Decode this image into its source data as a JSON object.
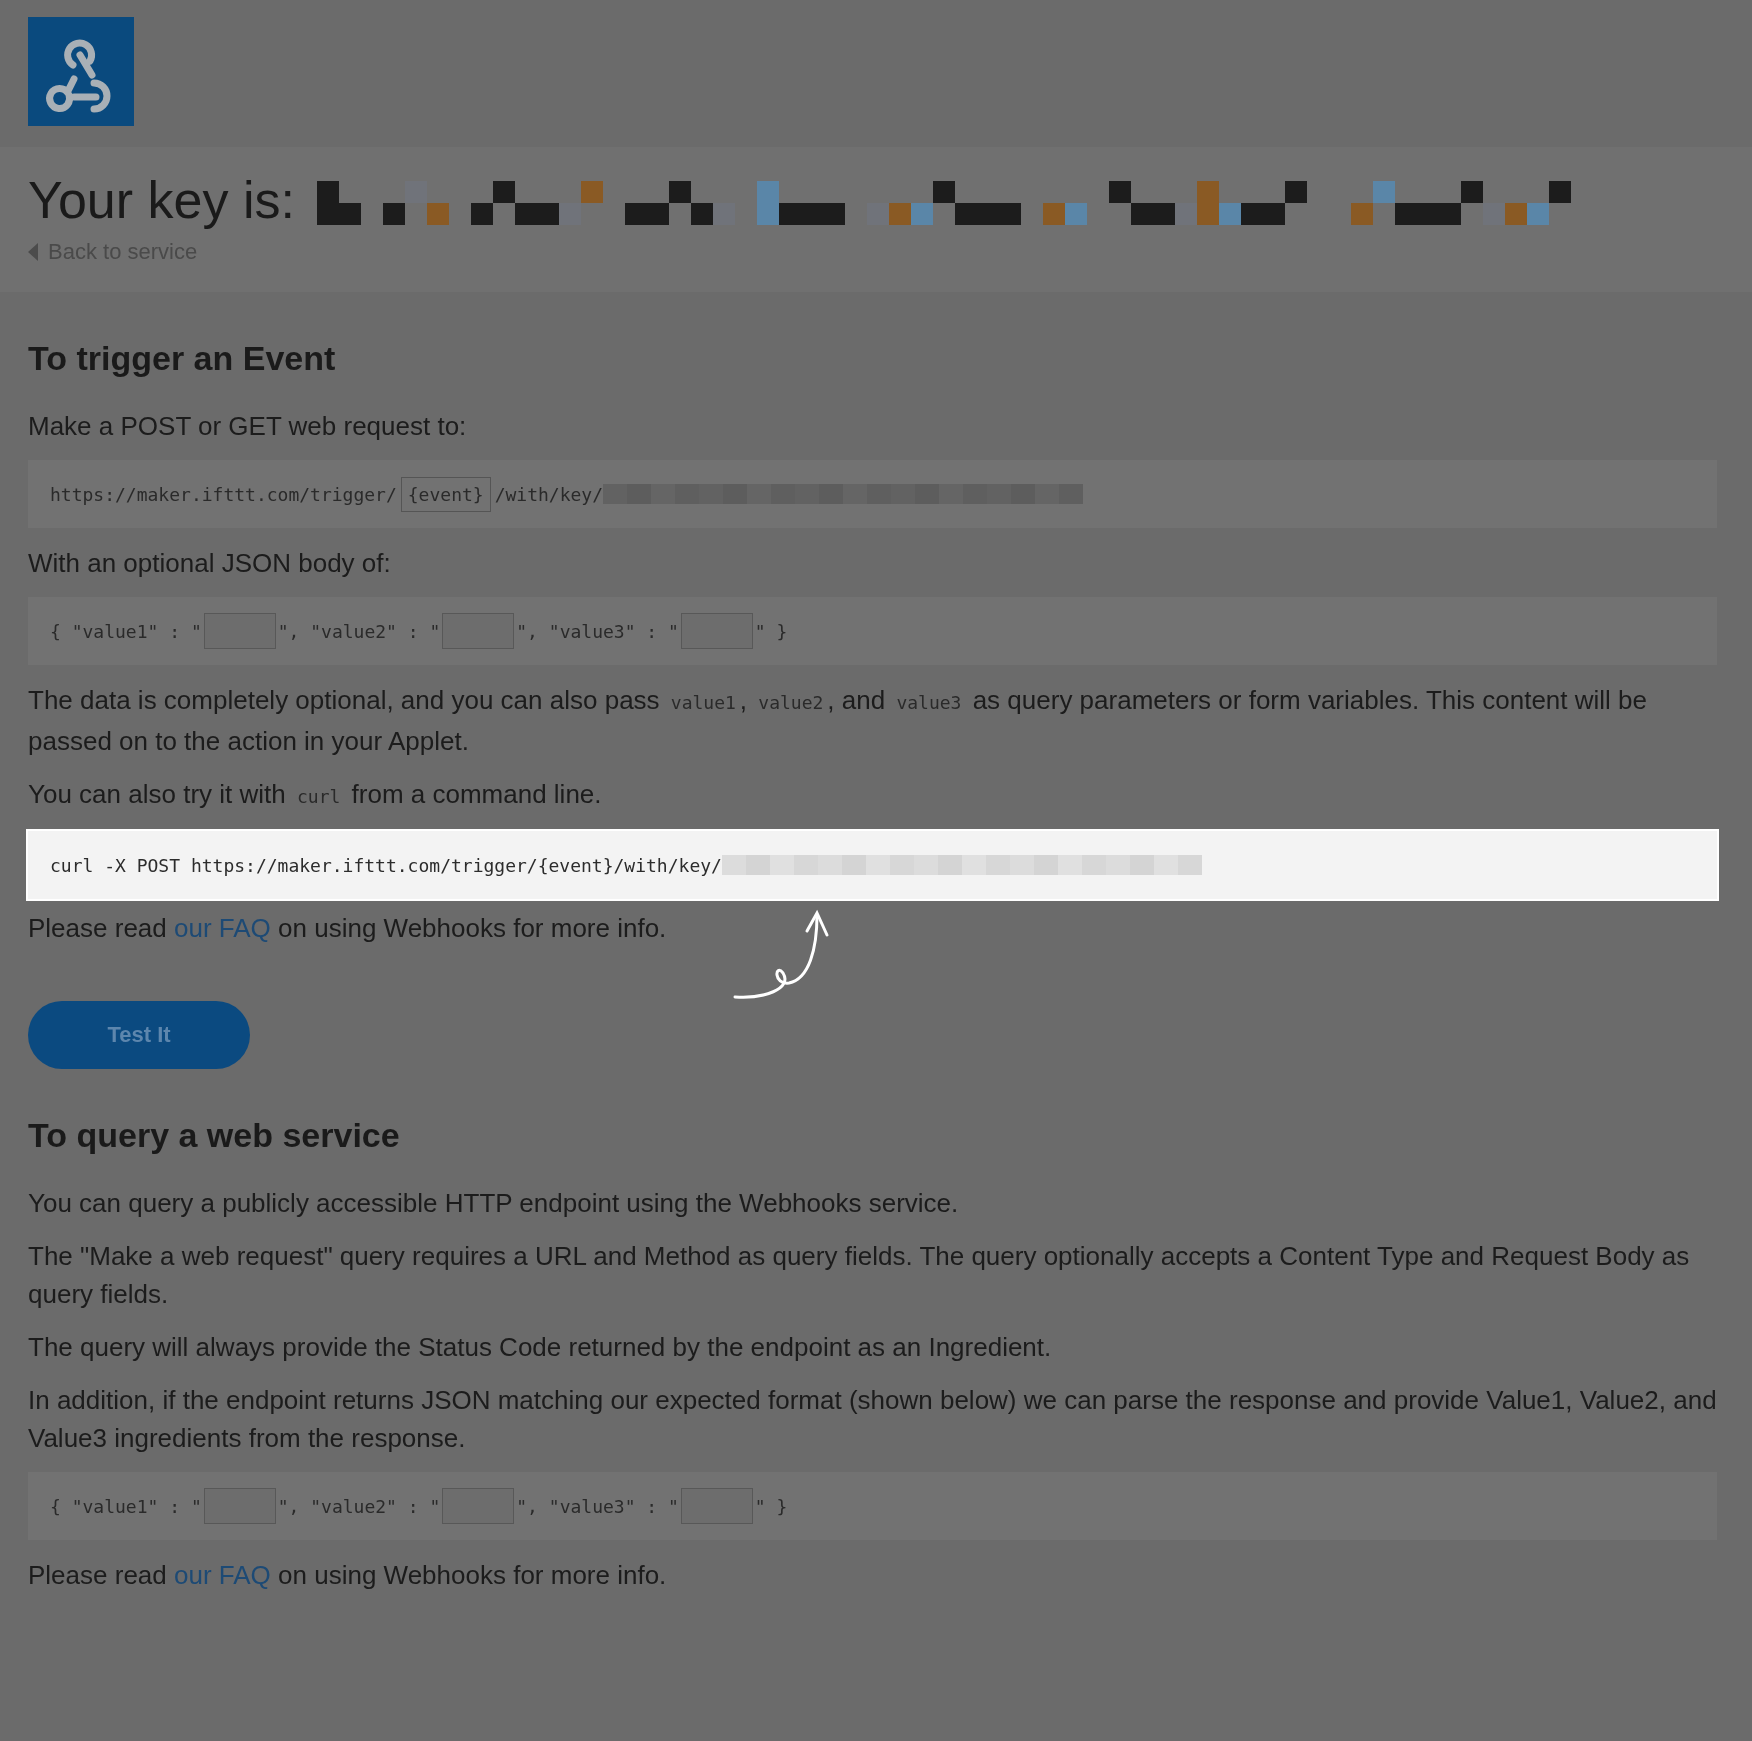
{
  "header": {
    "title": "Your key is:",
    "back_link": "Back to service"
  },
  "sections": [
    {
      "heading": "To trigger an Event",
      "blocks": [
        {
          "kind": "paragraph",
          "parts": [
            {
              "kind": "text",
              "text": "Make a POST or GET web request to:"
            }
          ]
        },
        {
          "kind": "code",
          "highlighted": false,
          "parts": [
            {
              "kind": "text",
              "text": "https://maker.ifttt.com/trigger/"
            },
            {
              "kind": "placeholder",
              "text": "{event}"
            },
            {
              "kind": "text",
              "text": "/with/key/"
            },
            {
              "kind": "redacted"
            }
          ]
        },
        {
          "kind": "paragraph",
          "parts": [
            {
              "kind": "text",
              "text": "With an optional JSON body of:"
            }
          ]
        },
        {
          "kind": "code",
          "highlighted": false,
          "parts": [
            {
              "kind": "text",
              "text": "{ \"value1\" : \""
            },
            {
              "kind": "field"
            },
            {
              "kind": "text",
              "text": "\", \"value2\" : \""
            },
            {
              "kind": "field"
            },
            {
              "kind": "text",
              "text": "\", \"value3\" : \""
            },
            {
              "kind": "field"
            },
            {
              "kind": "text",
              "text": "\" }"
            }
          ]
        },
        {
          "kind": "paragraph",
          "parts": [
            {
              "kind": "text",
              "text": "The data is completely optional, and you can also pass "
            },
            {
              "kind": "code",
              "text": "value1"
            },
            {
              "kind": "text",
              "text": ", "
            },
            {
              "kind": "code",
              "text": "value2"
            },
            {
              "kind": "text",
              "text": ", and "
            },
            {
              "kind": "code",
              "text": "value3"
            },
            {
              "kind": "text",
              "text": " as query parameters or form variables. This content will be passed on to the action in your Applet."
            }
          ]
        },
        {
          "kind": "paragraph",
          "parts": [
            {
              "kind": "text",
              "text": "You can also try it with "
            },
            {
              "kind": "code",
              "text": "curl"
            },
            {
              "kind": "text",
              "text": " from a command line."
            }
          ]
        },
        {
          "kind": "code",
          "highlighted": true,
          "parts": [
            {
              "kind": "text",
              "text": "curl -X POST https://maker.ifttt.com/trigger/{event}/with/key/"
            },
            {
              "kind": "redacted"
            }
          ]
        },
        {
          "kind": "paragraph",
          "annotated": true,
          "parts": [
            {
              "kind": "text",
              "text": "Please read "
            },
            {
              "kind": "link",
              "text": "our FAQ"
            },
            {
              "kind": "text",
              "text": " on using Webhooks for more info."
            }
          ]
        },
        {
          "kind": "button",
          "text": "Test It"
        }
      ]
    },
    {
      "heading": "To query a web service",
      "blocks": [
        {
          "kind": "paragraph",
          "parts": [
            {
              "kind": "text",
              "text": "You can query a publicly accessible HTTP endpoint using the Webhooks service."
            }
          ]
        },
        {
          "kind": "paragraph",
          "parts": [
            {
              "kind": "text",
              "text": "The \"Make a web request\" query requires a URL and Method as query fields. The query optionally accepts a Content Type and Request Body as query fields."
            }
          ]
        },
        {
          "kind": "paragraph",
          "parts": [
            {
              "kind": "text",
              "text": "The query will always provide the Status Code returned by the endpoint as an Ingredient."
            }
          ]
        },
        {
          "kind": "paragraph",
          "parts": [
            {
              "kind": "text",
              "text": "In addition, if the endpoint returns JSON matching our expected format (shown below) we can parse the response and provide Value1, Value2, and Value3 ingredients from the response."
            }
          ]
        },
        {
          "kind": "code",
          "highlighted": false,
          "parts": [
            {
              "kind": "text",
              "text": "{ \"value1\" : \""
            },
            {
              "kind": "field"
            },
            {
              "kind": "text",
              "text": "\", \"value2\" : \""
            },
            {
              "kind": "field"
            },
            {
              "kind": "text",
              "text": "\", \"value3\" : \""
            },
            {
              "kind": "field"
            },
            {
              "kind": "text",
              "text": "\" }"
            }
          ]
        },
        {
          "kind": "paragraph",
          "parts": [
            {
              "kind": "text",
              "text": "Please read "
            },
            {
              "kind": "link",
              "text": "our FAQ"
            },
            {
              "kind": "text",
              "text": " on using Webhooks for more info."
            }
          ]
        }
      ]
    }
  ]
}
